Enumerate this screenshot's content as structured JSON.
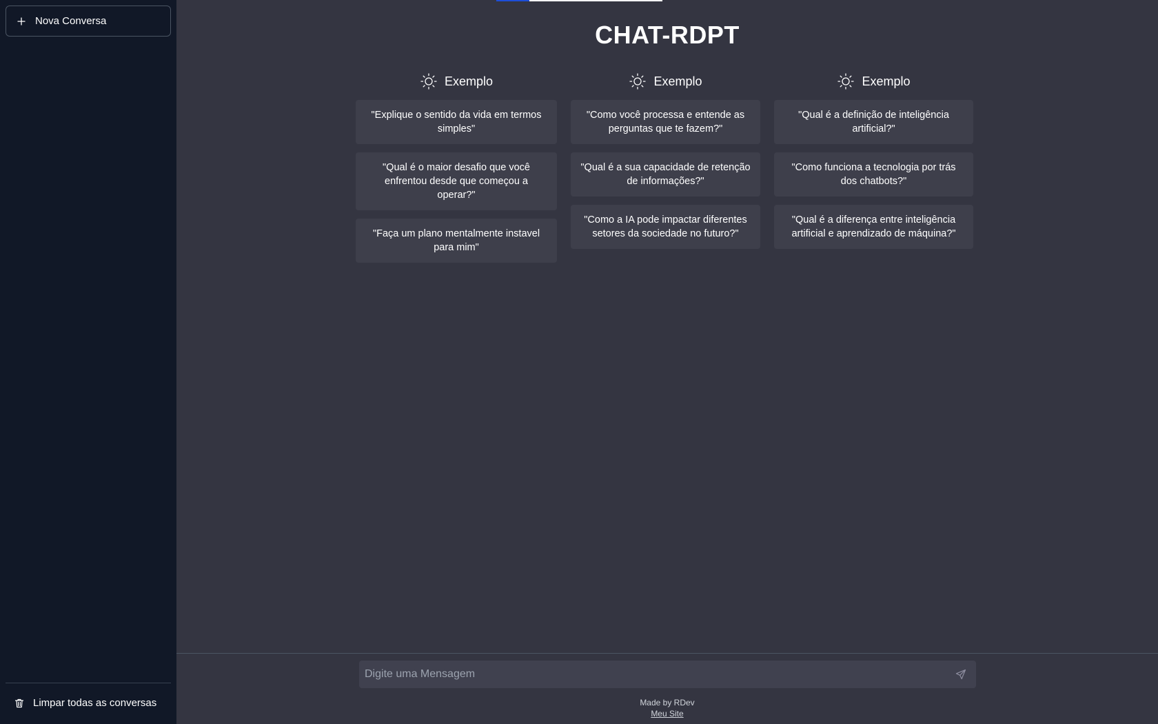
{
  "sidebar": {
    "new_chat_label": "Nova Conversa",
    "new_chat_icon": "plus-icon",
    "clear_label": "Limpar todas as conversas",
    "clear_icon": "trash-icon"
  },
  "header": {
    "title": "CHAT-RDPT"
  },
  "loading_progress": 0.2,
  "columns": [
    {
      "heading": "Exemplo",
      "icon": "sun-icon",
      "cards": [
        "\"Explique o sentido da vida em termos simples\"",
        "\"Qual é o maior desafio que você enfrentou desde que começou a operar?\"",
        "\"Faça um plano mentalmente instavel para mim\""
      ]
    },
    {
      "heading": "Exemplo",
      "icon": "sun-icon",
      "cards": [
        "\"Como você processa e entende as perguntas que te fazem?\"",
        "\"Qual é a sua capacidade de retenção de informações?\"",
        "\"Como a IA pode impactar diferentes setores da sociedade no futuro?\""
      ]
    },
    {
      "heading": "Exemplo",
      "icon": "sun-icon",
      "cards": [
        "\"Qual é a definição de inteligência artificial?\"",
        "\"Como funciona a tecnologia por trás dos chatbots?\"",
        "\"Qual é a diferença entre inteligência artificial e aprendizado de máquina?\""
      ]
    }
  ],
  "composer": {
    "placeholder": "Digite uma Mensagem",
    "value": "",
    "send_icon": "send-icon"
  },
  "footer": {
    "made_by": "Made by RDev",
    "link_label": "Meu Site"
  },
  "colors": {
    "sidebar_bg": "#111827",
    "main_bg": "#343541",
    "card_bg": "#3e3f4b",
    "input_bg": "#40414f",
    "accent": "#1d4ed8"
  }
}
